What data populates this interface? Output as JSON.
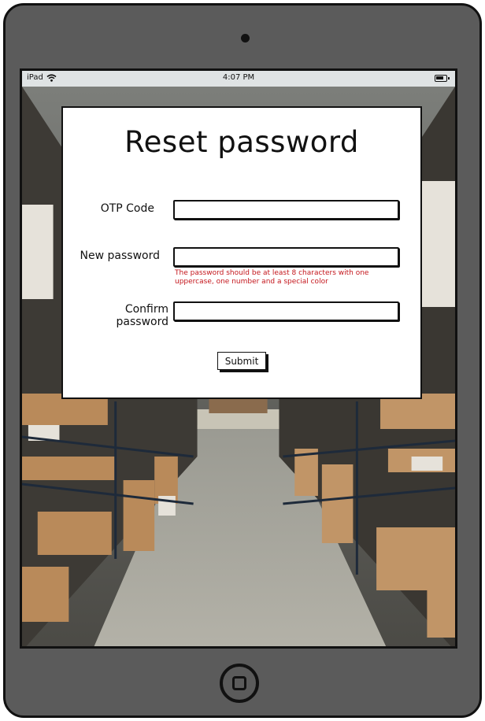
{
  "status_bar": {
    "device": "iPad",
    "time": "4:07 PM"
  },
  "form": {
    "title": "Reset password",
    "otp_label": "OTP Code",
    "otp_value": "",
    "new_password_label": "New password",
    "new_password_value": "",
    "password_hint": "The password should be at least 8 characters with one uppercase, one number and a special color",
    "confirm_password_label": "Confirm password",
    "confirm_password_value": "",
    "submit_label": "Submit"
  },
  "icons": {
    "wifi": "wifi-icon",
    "battery": "battery-icon",
    "home": "home-button-icon"
  },
  "colors": {
    "hint_text": "#c4161c",
    "device_frame": "#5b5b5b",
    "status_bar": "#dfe3e4"
  }
}
